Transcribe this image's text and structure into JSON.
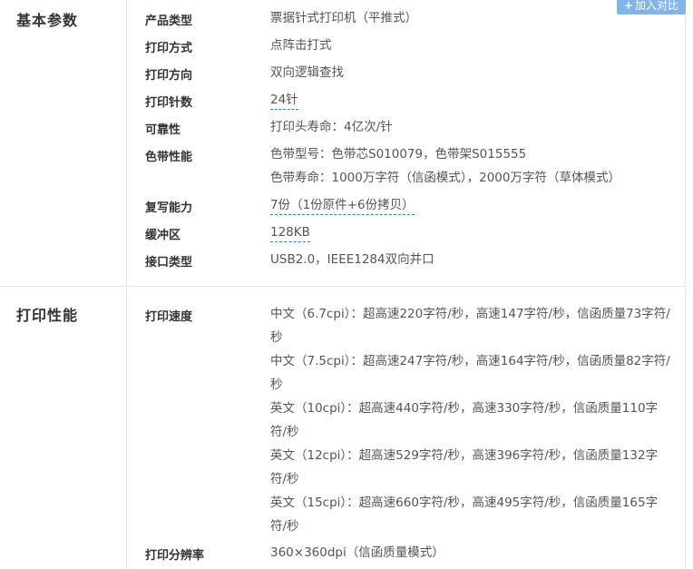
{
  "compare_button": {
    "plus": "+",
    "label": "加入对比"
  },
  "sections": [
    {
      "title": "基本参数",
      "rows": [
        {
          "label": "产品类型",
          "values": [
            "票据针式打印机（平推式）"
          ]
        },
        {
          "label": "打印方式",
          "values": [
            "点阵击打式"
          ]
        },
        {
          "label": "打印方向",
          "values": [
            "双向逻辑查找"
          ]
        },
        {
          "label": "打印针数",
          "values": [
            "24针"
          ]
        },
        {
          "label": "可靠性",
          "values": [
            "打印头寿命：4亿次/针"
          ]
        },
        {
          "label": "色带性能",
          "values": [
            "色带型号：色带芯S010079，色带架S015555",
            "色带寿命：1000万字符（信函模式），2000万字符（草体模式）"
          ]
        },
        {
          "label": "复写能力",
          "values": [
            "7份（1份原件+6份拷贝）"
          ]
        },
        {
          "label": "缓冲区",
          "values": [
            "128KB"
          ]
        },
        {
          "label": "接口类型",
          "values": [
            "USB2.0，IEEE1284双向并口"
          ]
        }
      ]
    },
    {
      "title": "打印性能",
      "rows": [
        {
          "label": "打印速度",
          "values": [
            "中文（6.7cpi）：超高速220字符/秒，高速147字符/秒，信函质量73字符/秒",
            "中文（7.5cpi）：超高速247字符/秒，高速164字符/秒，信函质量82字符/秒",
            "英文（10cpi）：超高速440字符/秒，高速330字符/秒，信函质量110字符/秒",
            "英文（12cpi）：超高速529字符/秒，高速396字符/秒，信函质量132字符/秒",
            "英文（15cpi）：超高速660字符/秒，高速495字符/秒，信函质量165字符/秒"
          ]
        },
        {
          "label": "打印分辨率",
          "values": [
            "360×360dpi（信函质量模式）"
          ]
        }
      ]
    }
  ]
}
